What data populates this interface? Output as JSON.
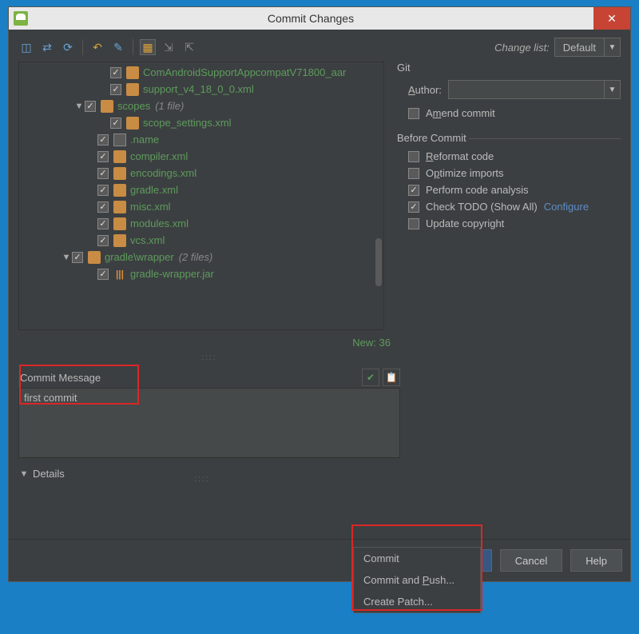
{
  "window": {
    "title": "Commit Changes"
  },
  "toolbar": {
    "changeListLabel": "Change list:",
    "changeList": "Default"
  },
  "tree": {
    "items": [
      {
        "indent": 100,
        "arrow": "",
        "check": true,
        "icon": "file",
        "name": "ComAndroidSupportAppcompatV71800_aar"
      },
      {
        "indent": 100,
        "arrow": "",
        "check": true,
        "icon": "file",
        "name": "support_v4_18_0_0.xml"
      },
      {
        "indent": 68,
        "arrow": "▼",
        "check": true,
        "icon": "folder",
        "name": "scopes",
        "count": "(1 file)"
      },
      {
        "indent": 100,
        "arrow": "",
        "check": true,
        "icon": "file",
        "name": "scope_settings.xml"
      },
      {
        "indent": 84,
        "arrow": "",
        "check": true,
        "icon": "doc",
        "name": ".name"
      },
      {
        "indent": 84,
        "arrow": "",
        "check": true,
        "icon": "xml",
        "name": "compiler.xml"
      },
      {
        "indent": 84,
        "arrow": "",
        "check": true,
        "icon": "xml",
        "name": "encodings.xml"
      },
      {
        "indent": 84,
        "arrow": "",
        "check": true,
        "icon": "xml",
        "name": "gradle.xml"
      },
      {
        "indent": 84,
        "arrow": "",
        "check": true,
        "icon": "xml",
        "name": "misc.xml"
      },
      {
        "indent": 84,
        "arrow": "",
        "check": true,
        "icon": "xml",
        "name": "modules.xml"
      },
      {
        "indent": 84,
        "arrow": "",
        "check": true,
        "icon": "xml",
        "name": "vcs.xml"
      },
      {
        "indent": 52,
        "arrow": "▼",
        "check": true,
        "icon": "folder",
        "name": "gradle\\wrapper",
        "count": "(2 files)"
      },
      {
        "indent": 84,
        "arrow": "",
        "check": true,
        "icon": "jar",
        "name": "gradle-wrapper.jar"
      }
    ]
  },
  "status": {
    "new": "New: 36"
  },
  "commit": {
    "label": "Commit Message",
    "message": "first commit"
  },
  "details": {
    "label": "Details"
  },
  "git": {
    "title": "Git",
    "authorLabel": "Author:",
    "authorValue": "",
    "amend": {
      "checked": false,
      "label": "Amend commit"
    }
  },
  "before": {
    "title": "Before Commit",
    "reformat": {
      "checked": false,
      "label": "Reformat code"
    },
    "optimize": {
      "checked": false,
      "label": "Optimize imports"
    },
    "analysis": {
      "checked": true,
      "label": "Perform code analysis"
    },
    "todo": {
      "checked": true,
      "label": "Check TODO (Show All)",
      "link": "Configure"
    },
    "copyright": {
      "checked": false,
      "label": "Update copyright"
    }
  },
  "buttons": {
    "commit": "Commit",
    "cancel": "Cancel",
    "help": "Help"
  },
  "menu": {
    "commit": "Commit",
    "commitPush": "Commit and Push...",
    "patch": "Create Patch..."
  }
}
